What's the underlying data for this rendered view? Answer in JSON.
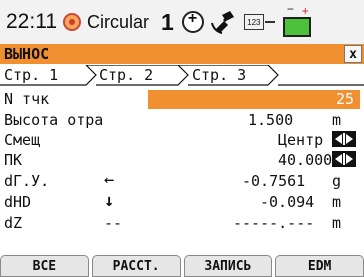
{
  "status": {
    "time": "22:11",
    "mode": "Circular",
    "face": "1",
    "keyboard_label": "123",
    "battery_plus": "+",
    "battery_minus": "−"
  },
  "title": "ВЫНОС",
  "close_label": "x",
  "tabs": [
    {
      "label": "Стр. 1",
      "active": true
    },
    {
      "label": "Стр. 2",
      "active": false
    },
    {
      "label": "Стр. 3",
      "active": false
    }
  ],
  "rows": {
    "ntchk": {
      "label": "N тчк",
      "value": "25"
    },
    "height": {
      "label": "Высота отра",
      "value": "1.500",
      "unit": "m"
    },
    "offset": {
      "label": "Смещ",
      "value": "Центр"
    },
    "pk": {
      "label": "ПК",
      "value": "40.000"
    },
    "dhz": {
      "label": "dГ.У.",
      "arrow": "←",
      "value": "-0.7561",
      "unit": "g"
    },
    "dhd": {
      "label": "dHD",
      "arrow": "↓",
      "value": "-0.094",
      "unit": "m"
    },
    "dz": {
      "label": "dZ",
      "arrow": "--",
      "value": "-----.---",
      "unit": "m"
    }
  },
  "softkeys": [
    "ВСЕ",
    "РАССТ.",
    "ЗАПИСЬ",
    "EDM"
  ],
  "colors": {
    "accent": "#f09030",
    "battery": "#4bc23a",
    "warning": "#d03a2a"
  }
}
